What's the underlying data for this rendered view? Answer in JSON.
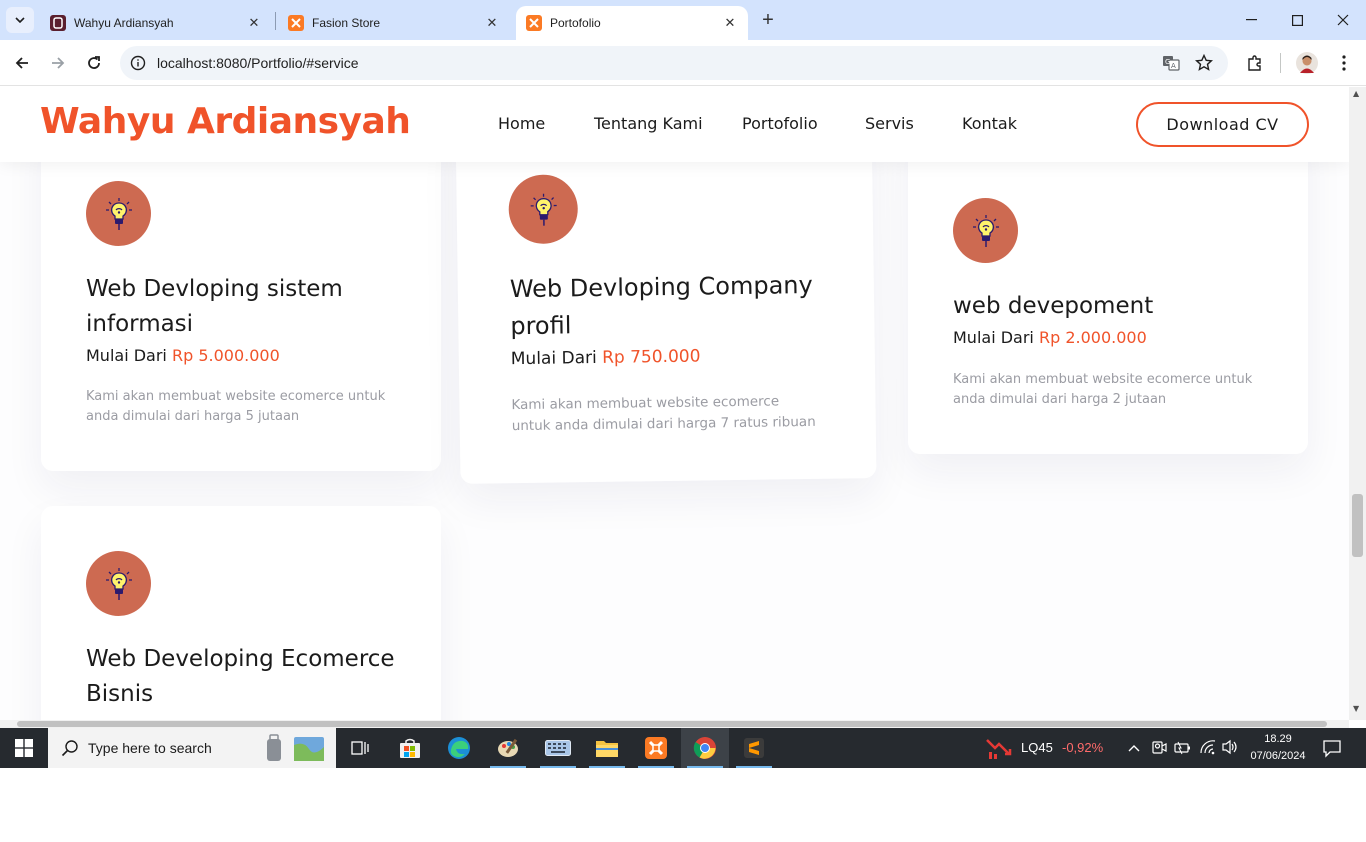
{
  "browser": {
    "tabs": [
      {
        "label": "Wahyu Ardiansyah",
        "active": false
      },
      {
        "label": "Fasion Store",
        "active": false
      },
      {
        "label": "Portofolio",
        "active": true
      }
    ],
    "url": "localhost:8080/Portfolio/#service"
  },
  "site": {
    "brand": "Wahyu Ardiansyah",
    "nav": [
      "Home",
      "Tentang Kami",
      "Portofolio",
      "Servis",
      "Kontak"
    ],
    "cta": "Download CV"
  },
  "services": [
    {
      "title": "Web Devloping sistem informasi",
      "price_prefix": "Mulai Dari",
      "price": "Rp 5.000.000",
      "desc": "Kami akan membuat website ecomerce untuk anda dimulai dari harga 5 jutaan"
    },
    {
      "title": "Web Devloping Company profil",
      "price_prefix": "Mulai Dari",
      "price": "Rp 750.000",
      "desc": "Kami akan membuat website ecomerce untuk anda dimulai dari harga 7 ratus ribuan"
    },
    {
      "title": "web devepoment",
      "price_prefix": "Mulai Dari",
      "price": "Rp 2.000.000",
      "desc": "Kami akan membuat website ecomerce untuk anda dimulai dari harga 2 jutaan"
    },
    {
      "title": "Web Developing Ecomerce Bisnis"
    }
  ],
  "taskbar": {
    "search_placeholder": "Type here to search",
    "stock_name": "LQ45",
    "stock_change": "-0,92%",
    "time": "18.29",
    "date": "07/06/2024"
  },
  "colors": {
    "accent": "#f0532a",
    "icon_bg": "#cd6a51",
    "tab_strip": "#d3e3fd"
  }
}
